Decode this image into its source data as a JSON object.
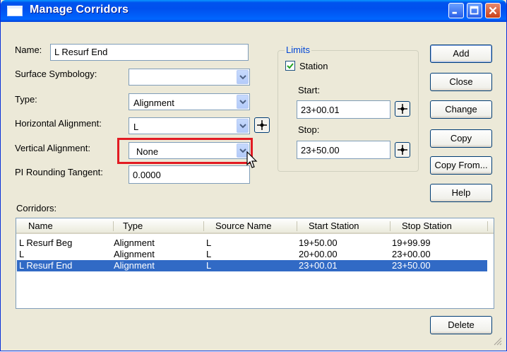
{
  "window": {
    "title": "Manage Corridors"
  },
  "form": {
    "name_label": "Name:",
    "name_value": "L Resurf End",
    "surface_symbology_label": "Surface Symbology:",
    "surface_symbology_value": "",
    "type_label": "Type:",
    "type_value": "Alignment",
    "horizontal_alignment_label": "Horizontal Alignment:",
    "horizontal_alignment_value": "L",
    "vertical_alignment_label": "Vertical Alignment:",
    "vertical_alignment_value": "None",
    "pi_rounding_label": "PI Rounding Tangent:",
    "pi_rounding_value": "0.0000"
  },
  "limits": {
    "group_label": "Limits",
    "station_checkbox_label": "Station",
    "station_checked": true,
    "start_label": "Start:",
    "start_value": "23+00.01",
    "stop_label": "Stop:",
    "stop_value": "23+50.00"
  },
  "buttons": {
    "add": "Add",
    "close": "Close",
    "change": "Change",
    "copy": "Copy",
    "copy_from": "Copy From...",
    "help": "Help",
    "delete": "Delete"
  },
  "corridors": {
    "label": "Corridors:",
    "columns": [
      "Name",
      "Type",
      "Source Name",
      "Start Station",
      "Stop Station"
    ],
    "rows": [
      [
        "L Resurf Beg",
        "Alignment",
        "L",
        "19+50.00",
        "19+99.99"
      ],
      [
        "L",
        "Alignment",
        "L",
        "20+00.00",
        "23+00.00"
      ],
      [
        "L Resurf End",
        "Alignment",
        "L",
        "23+00.01",
        "23+50.00"
      ]
    ],
    "selected_index": 2
  },
  "colors": {
    "highlight": "#e21b23",
    "selection": "#316ac5",
    "titlebar": "#0054e3"
  }
}
